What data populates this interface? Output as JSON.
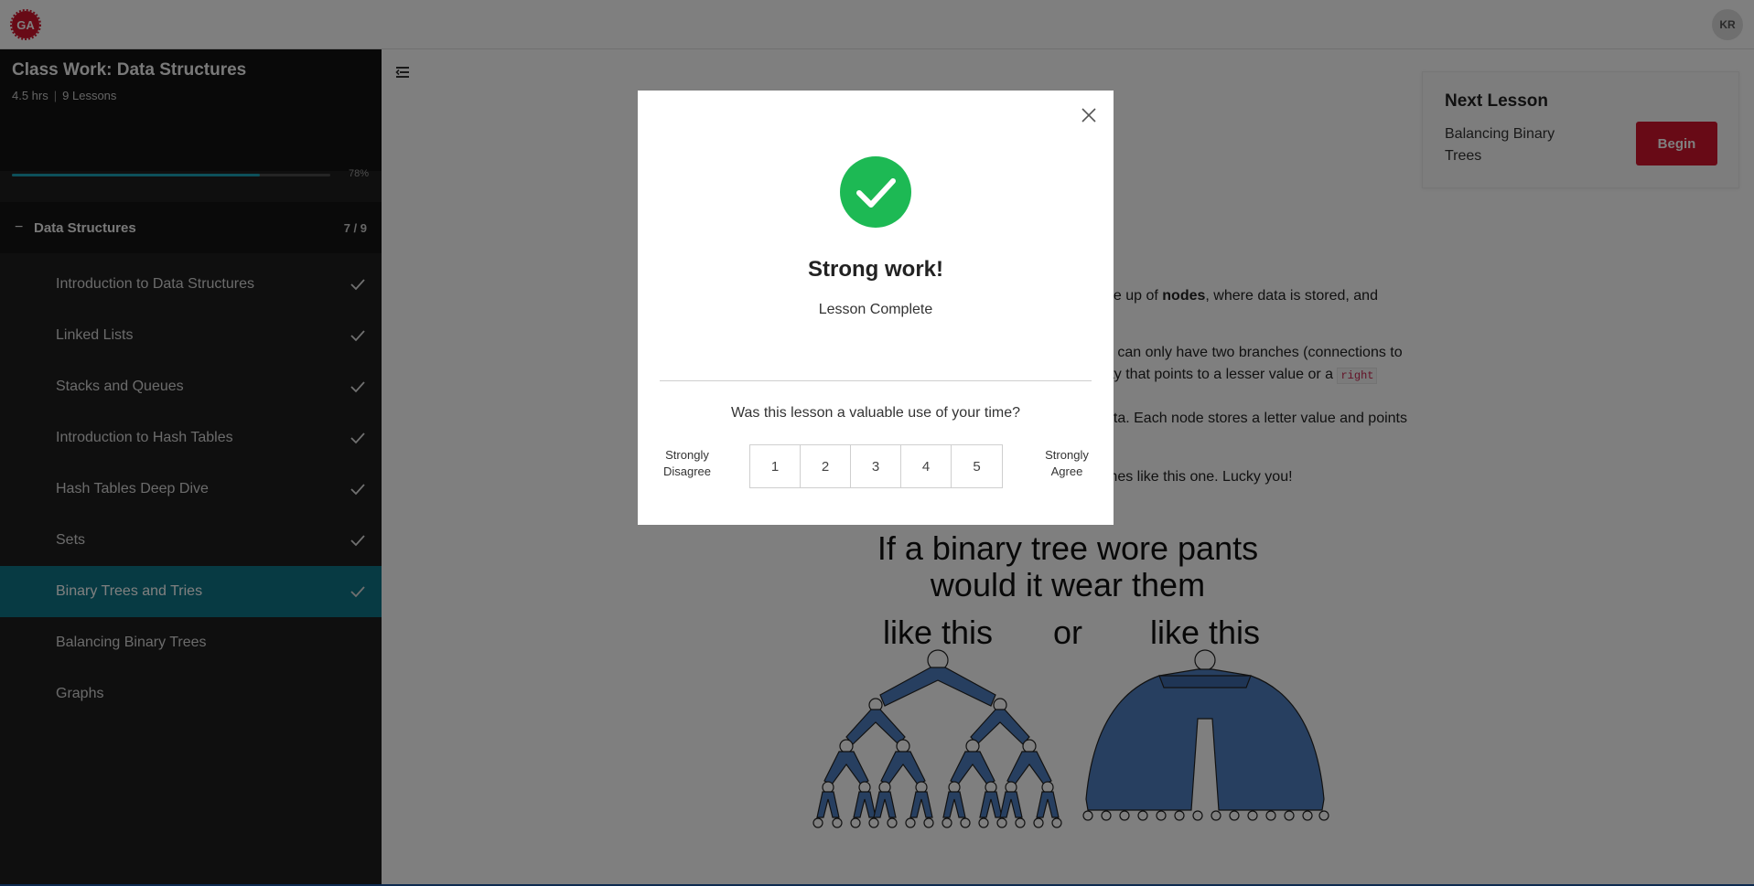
{
  "header": {
    "logo_text": "GA",
    "avatar_initials": "KR"
  },
  "sidebar": {
    "course_title": "Class Work: Data Structures",
    "duration": "4.5 hrs",
    "lesson_count": "9 Lessons",
    "progress_percent": 78,
    "progress_label": "78%",
    "section": {
      "toggle": "−",
      "title": "Data Structures",
      "count": "7 / 9"
    },
    "lessons": [
      {
        "label": "Introduction to Data Structures",
        "completed": true
      },
      {
        "label": "Linked Lists",
        "completed": true
      },
      {
        "label": "Stacks and Queues",
        "completed": true
      },
      {
        "label": "Introduction to Hash Tables",
        "completed": true
      },
      {
        "label": "Hash Tables Deep Dive",
        "completed": true
      },
      {
        "label": "Sets",
        "completed": true
      },
      {
        "label": "Binary Trees and Tries",
        "completed": true,
        "active": true
      },
      {
        "label": "Balancing Binary Trees",
        "completed": false
      },
      {
        "label": "Graphs",
        "completed": false
      }
    ]
  },
  "next_lesson": {
    "label": "Next Lesson",
    "title": "Balancing Binary Trees",
    "button": "Begin"
  },
  "content": {
    "p1_pre": "de up of ",
    "p1_bold": "nodes",
    "p1_post": ", where data is stored, and",
    "p2_line1": "e can only have two branches (connections to",
    "p2_line2_pre": "rty that points to a lesser value or a ",
    "p2_code": "right",
    "p3": "ata. Each node stores a letter value and points",
    "p4": "mes like this one. Lucky you!",
    "comic": {
      "line1": "If a binary tree wore pants",
      "line2": "would it wear them",
      "left_caption": "like this",
      "middle": "or",
      "right_caption": "like this"
    }
  },
  "modal": {
    "heading": "Strong work!",
    "subheading": "Lesson Complete",
    "question": "Was this lesson a valuable use of your time?",
    "scale_left_1": "Strongly",
    "scale_left_2": "Disagree",
    "scale_right_1": "Strongly",
    "scale_right_2": "Agree",
    "ratings": [
      "1",
      "2",
      "3",
      "4",
      "5"
    ]
  },
  "colors": {
    "accent_teal": "#0e7586",
    "brand_red": "#d0142c",
    "success_green": "#1db954",
    "jeans_blue": "#4f7fc0"
  }
}
